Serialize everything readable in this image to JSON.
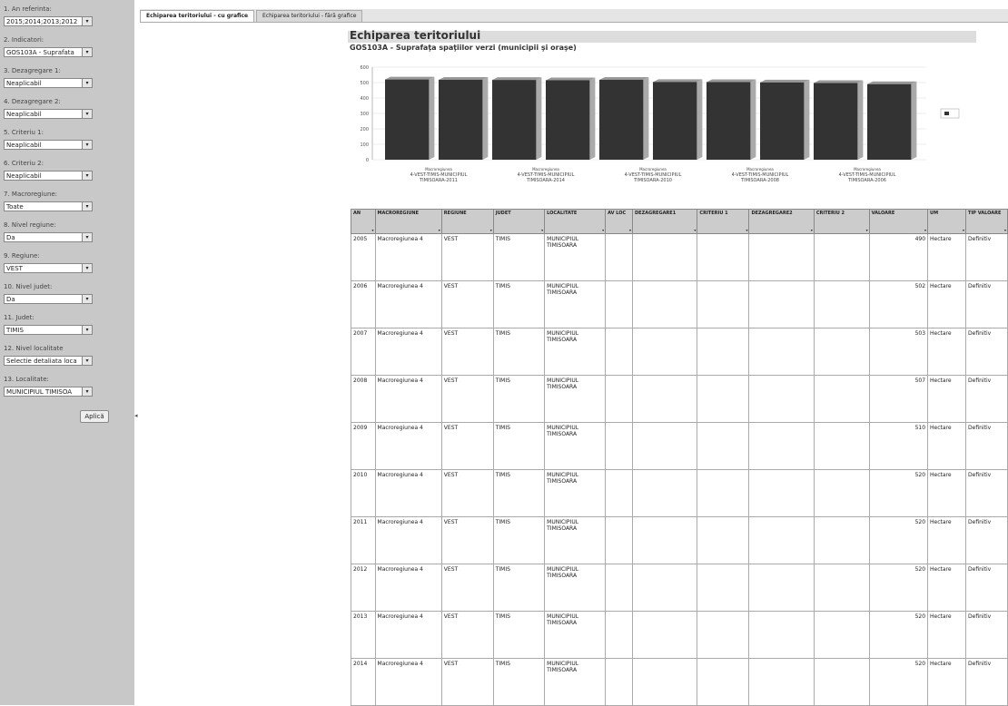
{
  "sidebar": {
    "fields": [
      {
        "label": "1. An referinta:",
        "value": "2015;2014;2013;2012"
      },
      {
        "label": "2. Indicatori:",
        "value": "GOS103A - Suprafata"
      },
      {
        "label": "3. Dezagregare 1:",
        "value": "Neaplicabil"
      },
      {
        "label": "4. Dezagregare 2:",
        "value": "Neaplicabil"
      },
      {
        "label": "5. Criteriu 1:",
        "value": "Neaplicabil"
      },
      {
        "label": "6. Criteriu 2:",
        "value": "Neaplicabil"
      },
      {
        "label": "7. Macroregiune:",
        "value": "Toate"
      },
      {
        "label": "8. Nivel regiune:",
        "value": "Da"
      },
      {
        "label": "9. Regiune:",
        "value": "VEST"
      },
      {
        "label": "10. Nivel judet:",
        "value": "Da"
      },
      {
        "label": "11. Judet:",
        "value": "TIMIS"
      },
      {
        "label": "12. Nivel localitate",
        "value": "Selectie detaliata loca"
      },
      {
        "label": "13. Localitate:",
        "value": "MUNICIPIUL TIMISOA"
      }
    ],
    "apply_label": "Aplică",
    "collapse_glyph": "◂"
  },
  "tabs": [
    {
      "label": "Echiparea teritoriului - cu grafice"
    },
    {
      "label": "Echiparea teritoriului - fără grafice"
    }
  ],
  "content": {
    "title": "Echiparea teritoriului",
    "subtitle": "GOS103A - Suprafaţa spaţiilor verzi (municipii şi oraşe)"
  },
  "chart_data": {
    "type": "bar",
    "y_ticks": [
      "600",
      "500",
      "400",
      "300",
      "200",
      "100",
      "0"
    ],
    "ylim": [
      0,
      600
    ],
    "values": [
      520,
      518,
      517,
      515,
      518,
      504,
      503,
      501,
      497,
      490
    ],
    "x_labels": [
      {
        "line1": "Macroregiunea",
        "line2": "4-VEST-TIMIS-MUNICIPIUL",
        "line3": "TIMISOARA-2011"
      },
      {
        "line1": "Macroregiunea",
        "line2": "4-VEST-TIMIS-MUNICIPIUL",
        "line3": "TIMISOARA-2014"
      },
      {
        "line1": "Macroregiunea",
        "line2": "4-VEST-TIMIS-MUNICIPIUL",
        "line3": "TIMISOARA-2010"
      },
      {
        "line1": "Macroregiunea",
        "line2": "4-VEST-TIMIS-MUNICIPIUL",
        "line3": "TIMISOARA-2008"
      },
      {
        "line1": "Macroregiunea",
        "line2": "4-VEST-TIMIS-MUNICIPIUL",
        "line3": "TIMISOARA-2006"
      }
    ],
    "bar_color": "#333333",
    "legend_position": "right"
  },
  "table": {
    "headers": [
      "AN",
      "MACROREGIUNE",
      "REGIUNE",
      "JUDET",
      "LOCALITATE",
      "AV LOC",
      "DEZAGREGARE1",
      "CRITERIU 1",
      "DEZAGREGARE2",
      "CRITERIU 2",
      "VALOARE",
      "UM",
      "TIP VALOARE"
    ],
    "rows": [
      [
        "2005",
        "Macroregiunea 4",
        "VEST",
        "TIMIS",
        "MUNICIPIUL TIMISOARA",
        "",
        "",
        "",
        "",
        "",
        "490",
        "Hectare",
        "Definitiv"
      ],
      [
        "2006",
        "Macroregiunea 4",
        "VEST",
        "TIMIS",
        "MUNICIPIUL TIMISOARA",
        "",
        "",
        "",
        "",
        "",
        "502",
        "Hectare",
        "Definitiv"
      ],
      [
        "2007",
        "Macroregiunea 4",
        "VEST",
        "TIMIS",
        "MUNICIPIUL TIMISOARA",
        "",
        "",
        "",
        "",
        "",
        "503",
        "Hectare",
        "Definitiv"
      ],
      [
        "2008",
        "Macroregiunea 4",
        "VEST",
        "TIMIS",
        "MUNICIPIUL TIMISOARA",
        "",
        "",
        "",
        "",
        "",
        "507",
        "Hectare",
        "Definitiv"
      ],
      [
        "2009",
        "Macroregiunea 4",
        "VEST",
        "TIMIS",
        "MUNICIPIUL TIMISOARA",
        "",
        "",
        "",
        "",
        "",
        "510",
        "Hectare",
        "Definitiv"
      ],
      [
        "2010",
        "Macroregiunea 4",
        "VEST",
        "TIMIS",
        "MUNICIPIUL TIMISOARA",
        "",
        "",
        "",
        "",
        "",
        "520",
        "Hectare",
        "Definitiv"
      ],
      [
        "2011",
        "Macroregiunea 4",
        "VEST",
        "TIMIS",
        "MUNICIPIUL TIMISOARA",
        "",
        "",
        "",
        "",
        "",
        "520",
        "Hectare",
        "Definitiv"
      ],
      [
        "2012",
        "Macroregiunea 4",
        "VEST",
        "TIMIS",
        "MUNICIPIUL TIMISOARA",
        "",
        "",
        "",
        "",
        "",
        "520",
        "Hectare",
        "Definitiv"
      ],
      [
        "2013",
        "Macroregiunea 4",
        "VEST",
        "TIMIS",
        "MUNICIPIUL TIMISOARA",
        "",
        "",
        "",
        "",
        "",
        "520",
        "Hectare",
        "Definitiv"
      ],
      [
        "2014",
        "Macroregiunea 4",
        "VEST",
        "TIMIS",
        "MUNICIPIUL TIMISOARA",
        "",
        "",
        "",
        "",
        "",
        "520",
        "Hectare",
        "Definitiv"
      ]
    ]
  }
}
